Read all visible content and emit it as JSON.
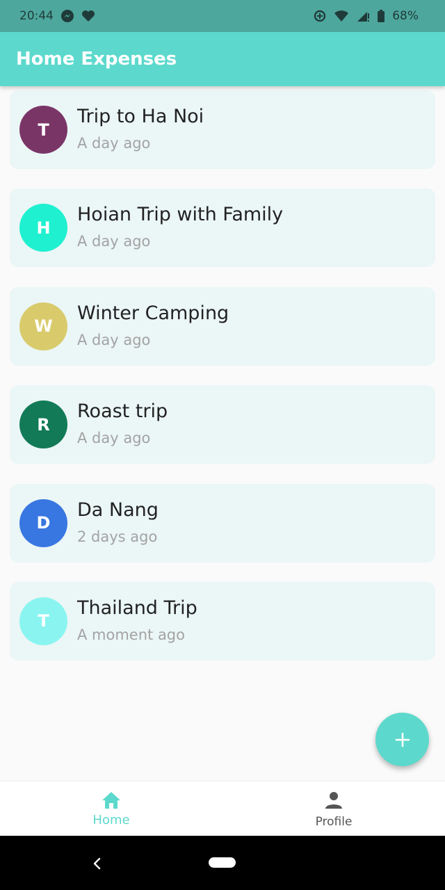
{
  "status_bar": {
    "time": "20:44",
    "battery": "68%",
    "icons": [
      "messenger-icon",
      "heart-icon",
      "data-saver-icon",
      "wifi-icon",
      "signal-icon",
      "battery-icon"
    ]
  },
  "app_bar": {
    "title": "Home Expenses"
  },
  "trips": [
    {
      "initial": "T",
      "title": "Trip to Ha Noi",
      "subtitle": "A day ago",
      "color": "#7a3567"
    },
    {
      "initial": "H",
      "title": "Hoian Trip with Family",
      "subtitle": "A day ago",
      "color": "#1ff0d0"
    },
    {
      "initial": "W",
      "title": "Winter Camping",
      "subtitle": "A day ago",
      "color": "#d9cb6c"
    },
    {
      "initial": "R",
      "title": "Roast trip",
      "subtitle": "A day ago",
      "color": "#127a57"
    },
    {
      "initial": "D",
      "title": "Da Nang",
      "subtitle": "2 days ago",
      "color": "#3877e1"
    },
    {
      "initial": "T",
      "title": "Thailand Trip",
      "subtitle": "A moment ago",
      "color": "#8af5f0"
    }
  ],
  "fab": {
    "icon": "plus-icon"
  },
  "bottom_nav": {
    "home": {
      "label": "Home",
      "icon": "home-icon",
      "active": true
    },
    "profile": {
      "label": "Profile",
      "icon": "person-icon",
      "active": false
    }
  },
  "colors": {
    "accent": "#5cd9cc",
    "status_bar": "#4ea79d",
    "card_background": "#ebf6f6",
    "inactive_nav": "#555555"
  }
}
